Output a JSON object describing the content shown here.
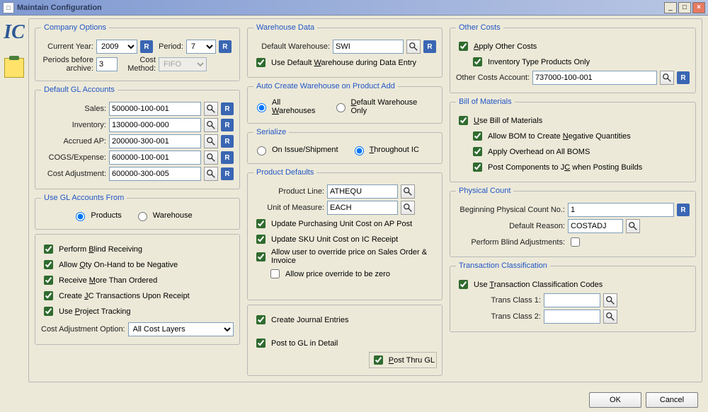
{
  "window": {
    "title": "Maintain Configuration"
  },
  "ic_logo": "IC",
  "company": {
    "legend": "Company Options",
    "current_year_lbl": "Current Year:",
    "current_year_val": "2009",
    "period_lbl": "Period:",
    "period_val": "7",
    "periods_before_lbl": "Periods before archive:",
    "periods_before_lbl1": "Periods before",
    "periods_before_lbl2": "archive:",
    "periods_before_val": "3",
    "cost_method_lbl1": "Cost",
    "cost_method_lbl2": "Method:",
    "cost_method_val": "FIFO"
  },
  "gl": {
    "legend": "Default GL Accounts",
    "sales_lbl": "Sales:",
    "sales_val": "500000-100-001",
    "inventory_lbl": "Inventory:",
    "inventory_val": "130000-000-000",
    "accrued_lbl": "Accrued AP:",
    "accrued_val": "200000-300-001",
    "cogs_lbl": "COGS/Expense:",
    "cogs_val": "600000-100-001",
    "costadj_lbl": "Cost Adjustment:",
    "costadj_val": "600000-300-005"
  },
  "glfrom": {
    "legend": "Use GL Accounts From",
    "products": "Products",
    "warehouse": "Warehouse"
  },
  "leftchecks": {
    "blind_recv_pre": "Perform ",
    "blind_recv_u": "B",
    "blind_recv_post": "lind Receiving",
    "qty_neg_pre": "Allow ",
    "qty_neg_u": "Q",
    "qty_neg_post": "ty On-Hand to be Negative",
    "recv_more_pre": "Receive ",
    "recv_more_u": "M",
    "recv_more_post": "ore Than Ordered",
    "jc_trans_pre": "Create ",
    "jc_trans_u": "J",
    "jc_trans_post": "C Transactions Upon Receipt",
    "proj_track_pre": "Use ",
    "proj_track_u": "P",
    "proj_track_post": "roject Tracking",
    "cost_adj_opt_lbl": "Cost Adjustment Option:",
    "cost_adj_opt_val": "All Cost Layers"
  },
  "whd": {
    "legend": "Warehouse Data",
    "default_wh_lbl": "Default Warehouse:",
    "default_wh_val": "SWI",
    "use_default_pre": "Use Default ",
    "use_default_u": "W",
    "use_default_post": "arehouse during Data Entry"
  },
  "autocrt": {
    "legend": "Auto Create Warehouse on Product Add",
    "all_pre": "All ",
    "all_u": "W",
    "all_post": "arehouses",
    "def_pre": "",
    "def_u": "D",
    "def_post": "efault Warehouse Only"
  },
  "serial": {
    "legend": "Serialize",
    "onissue": "On Issue/Shipment",
    "through_u": "T",
    "through_post": "hroughout IC"
  },
  "pdef": {
    "legend": "Product Defaults",
    "pline_lbl": "Product Line:",
    "pline_val": "ATHEQU",
    "uom_lbl": "Unit of Measure:",
    "uom_val": "EACH",
    "upd_pur": "Update Purchasing Unit Cost on AP Post",
    "upd_sku": "Update SKU Unit Cost on IC Receipt",
    "override": "Allow user to override price on Sales Order & Invoice",
    "override_zero": "Allow price override to be zero"
  },
  "journal": {
    "create_je": "Create Journal Entries",
    "post_detail": "Post to GL in Detail",
    "post_thru_u": "P",
    "post_thru_post": "ost Thru GL"
  },
  "other": {
    "legend": "Other Costs",
    "apply_pre": "",
    "apply_u": "A",
    "apply_post": "pply Other Costs",
    "inv_type": "Inventory Type Products Only",
    "acct_lbl": "Other Costs Account:",
    "acct_val": "737000-100-001"
  },
  "bom": {
    "legend": "Bill of Materials",
    "use_pre": "",
    "use_u": "U",
    "use_post": "se Bill of Materials",
    "neg_pre": "Allow BOM to Create ",
    "neg_u": "N",
    "neg_post": "egative Quantities",
    "ovh": "Apply Overhead on All BOMS",
    "postjc_pre": "Post Components to J",
    "postjc_u": "C",
    "postjc_post": " when Posting Builds"
  },
  "phys": {
    "legend": "Physical Count",
    "begin_lbl": "Beginning Physical Count No.:",
    "begin_val": "1",
    "reason_lbl": "Default Reason:",
    "reason_val": "COSTADJ",
    "blind_adj_lbl": "Perform Blind Adjustments:"
  },
  "xclass": {
    "legend": "Transaction Classification",
    "use_pre": "Use ",
    "use_u": "T",
    "use_post": "ransaction Classification Codes",
    "tc1_lbl": "Trans Class 1:",
    "tc1_val": "",
    "tc2_lbl": "Trans Class 2:",
    "tc2_val": ""
  },
  "buttons": {
    "ok": "OK",
    "cancel": "Cancel"
  }
}
